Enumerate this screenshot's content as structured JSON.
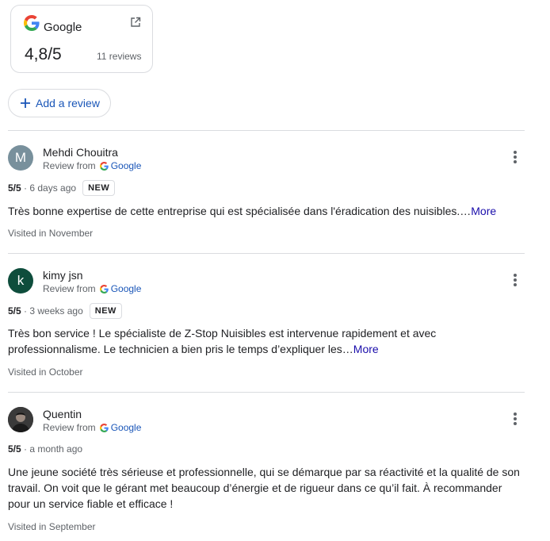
{
  "summary": {
    "provider": "Google",
    "rating": "4,8/5",
    "review_count": "11 reviews"
  },
  "add_review_label": "Add a review",
  "reviews": [
    {
      "initial": "M",
      "avatar_color": "#78909c",
      "name": "Mehdi Chouitra",
      "review_from": "Review from",
      "source": "Google",
      "rating": "5/5",
      "age": "· 6 days ago",
      "badge": "NEW",
      "text": "Très bonne expertise de cette entreprise qui est spécialisée dans l'éradication des nuisibles.…",
      "more": "More",
      "visited": "Visited in November"
    },
    {
      "initial": "k",
      "avatar_color": "#0e4d3c",
      "name": "kimy jsn",
      "review_from": "Review from",
      "source": "Google",
      "rating": "5/5",
      "age": "· 3 weeks ago",
      "badge": "NEW",
      "text": "Très bon service ! Le spécialiste de Z-Stop Nuisibles est intervenue rapidement et avec professionnalisme. Le technicien a bien pris le temps d’expliquer les…",
      "more": "More",
      "visited": "Visited in October"
    },
    {
      "initial": "",
      "avatar_color": "#2b2b2b",
      "name": "Quentin",
      "review_from": "Review from",
      "source": "Google",
      "rating": "5/5",
      "age": "· a month ago",
      "text": "Une jeune société très sérieuse et professionnelle, qui se démarque par sa réactivité et la qualité de son travail. On voit que le gérant met beaucoup d’énergie et de rigueur dans ce qu’il fait. À recommander pour un service fiable et efficace !",
      "visited": "Visited in September"
    }
  ]
}
